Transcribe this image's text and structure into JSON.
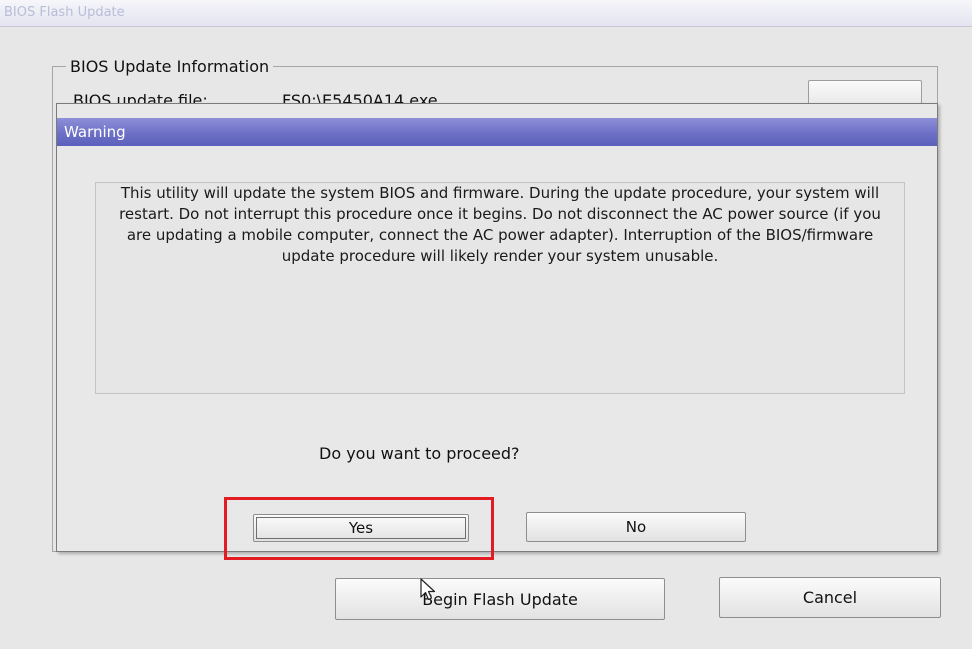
{
  "window": {
    "title": "BIOS Flash Update"
  },
  "info_group": {
    "legend": "BIOS Update Information",
    "file_label": "BIOS update file:",
    "file_value": "FS0:\\E5450A14.exe"
  },
  "dialog": {
    "title": "Warning",
    "message": "This utility will update the system BIOS and firmware.  During the update procedure, your system will restart. Do not interrupt this procedure once it begins.  Do not disconnect the AC power source (if you are updating a mobile computer, connect the AC power adapter).  Interruption of the BIOS/firmware update procedure will likely render your system unusable.",
    "question": "Do you want to proceed?",
    "yes_label": "Yes",
    "no_label": "No"
  },
  "footer": {
    "begin_label": "Begin Flash Update",
    "cancel_label": "Cancel"
  },
  "colors": {
    "dialog_header": "#6d70c6",
    "highlight": "#e31b23",
    "background": "#e7e7e7"
  }
}
